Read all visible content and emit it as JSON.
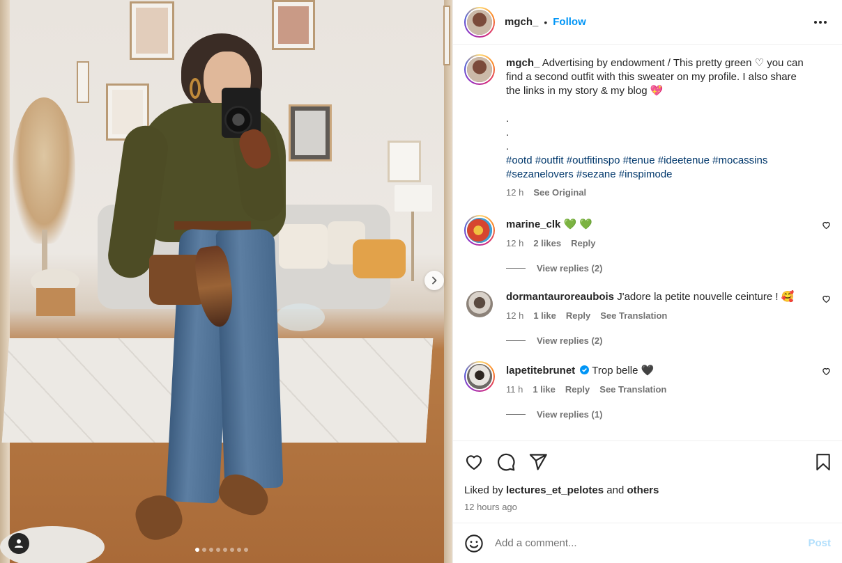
{
  "header": {
    "username": "mgch_",
    "separator": "•",
    "follow_label": "Follow"
  },
  "caption": {
    "username": "mgch_",
    "text": "Advertising by endowment / This pretty green ♡ you can find a second outfit with this sweater on my profile. I also share the links in my story & my blog 💖",
    "dots": ".",
    "hashtags": [
      "#ootd",
      "#outfit",
      "#outfitinspo",
      "#tenue",
      "#ideetenue",
      "#mocassins",
      "#sezanelovers",
      "#sezane",
      "#inspimode"
    ],
    "time": "12 h",
    "see_original": "See Original"
  },
  "comments": [
    {
      "username": "marine_clk",
      "text": "💚 💚",
      "time": "12 h",
      "likes": "2 likes",
      "reply": "Reply",
      "translate": "",
      "view_replies": "View replies (2)",
      "avatar_color": "#d6452f",
      "ring": true
    },
    {
      "username": "dormantauroreaubois",
      "text": "J'adore la petite nouvelle ceinture ! 🥰",
      "time": "12 h",
      "likes": "1 like",
      "reply": "Reply",
      "translate": "See Translation",
      "view_replies": "View replies (2)",
      "avatar_color": "#9a8f85",
      "ring": false
    },
    {
      "username": "lapetitebrunet",
      "text": "Trop belle 🖤",
      "time": "11 h",
      "likes": "1 like",
      "reply": "Reply",
      "translate": "See Translation",
      "view_replies": "View replies (1)",
      "avatar_color": "#6d6a66",
      "ring": true,
      "verified": true
    }
  ],
  "actions": {
    "liked_by_prefix": "Liked by",
    "liked_by_user": "lectures_et_pelotes",
    "liked_by_and": "and",
    "liked_by_others": "others",
    "time_ago": "12 hours ago"
  },
  "add_comment": {
    "placeholder": "Add a comment...",
    "post_label": "Post"
  },
  "carousel": {
    "total": 8,
    "current": 1
  },
  "icons": {
    "like": "heart-icon",
    "comment": "comment-icon",
    "share": "share-icon",
    "save": "bookmark-icon",
    "emoji": "emoji-icon",
    "more": "more-options-icon",
    "next": "chevron-right-icon",
    "tag": "user-tag-icon"
  },
  "colors": {
    "link_blue": "#0095f6",
    "hashtag": "#00376b",
    "muted": "#737373",
    "post_disabled": "#b2dffc"
  }
}
